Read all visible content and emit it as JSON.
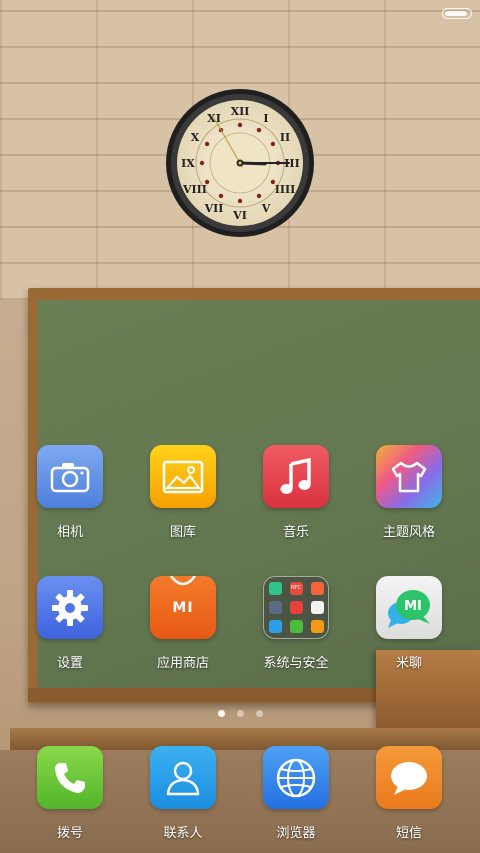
{
  "status": {
    "battery_level": 0.9
  },
  "clock": {
    "hour_hand_deg": 92,
    "minute_hand_deg": 90,
    "second_hand_deg": 330
  },
  "home": {
    "row1": [
      {
        "label": "相机",
        "icon": "camera-icon"
      },
      {
        "label": "图库",
        "icon": "gallery-icon"
      },
      {
        "label": "音乐",
        "icon": "music-note-icon"
      },
      {
        "label": "主题风格",
        "icon": "tshirt-icon"
      }
    ],
    "row2": [
      {
        "label": "设置",
        "icon": "gear-icon"
      },
      {
        "label": "应用商店",
        "icon": "mi-bag-icon",
        "badge": "MI"
      },
      {
        "label": "系统与安全",
        "icon": "folder-icon",
        "mini": [
          "NFC"
        ]
      },
      {
        "label": "米聊",
        "icon": "chat-mi-icon",
        "badge": "MI"
      }
    ],
    "pages": 3,
    "current_page": 1
  },
  "dock": [
    {
      "label": "拨号",
      "icon": "phone-icon"
    },
    {
      "label": "联系人",
      "icon": "contact-icon"
    },
    {
      "label": "浏览器",
      "icon": "globe-icon"
    },
    {
      "label": "短信",
      "icon": "message-icon"
    }
  ],
  "colors": {
    "camera": "#5b8fe3",
    "gallery": "#f5b400",
    "music": "#e8434f",
    "settings": "#4b6fe8",
    "store": "#f06a1f",
    "phone": "#6ac73c",
    "contacts": "#2a9ee8",
    "browser": "#2d7bea",
    "messages": "#f08a24"
  }
}
